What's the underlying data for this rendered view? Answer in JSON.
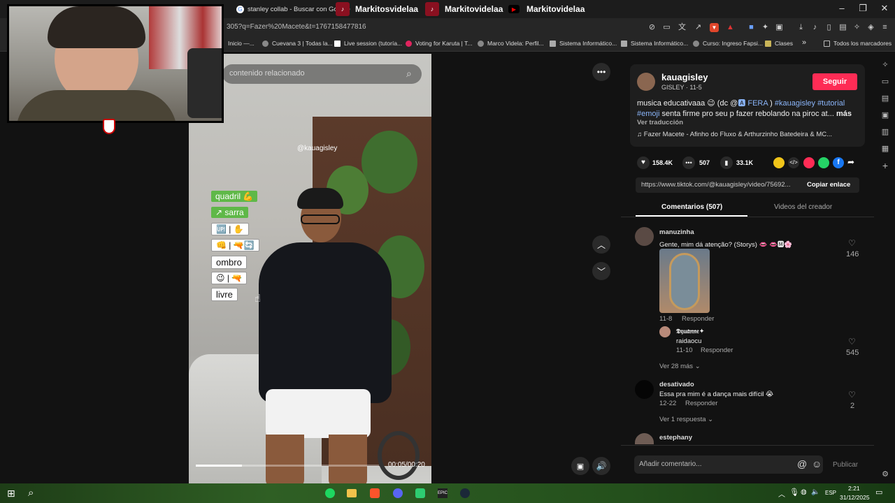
{
  "tabs": [
    {
      "label": "stanley collab - Buscar con Google"
    },
    {
      "label": "Markitosvidelaa"
    },
    {
      "label": "Markitovidelaa"
    },
    {
      "label": "Markitovidelaa"
    }
  ],
  "address_bar": {
    "url": "305?q=Fazer%20Macete&t=1767158477816"
  },
  "bookmarks": [
    {
      "label": "Inicio —..."
    },
    {
      "label": "Cuevana 3 | Todas la..."
    },
    {
      "label": "Live session (tutoría..."
    },
    {
      "label": "Voting for Karuta | T..."
    },
    {
      "label": "Marco Videla: Perfil..."
    },
    {
      "label": "Sistema Informático..."
    },
    {
      "label": "Sistema Informático..."
    },
    {
      "label": "Curso: Ingreso Fapsi..."
    },
    {
      "label": "Clases"
    },
    {
      "label": "»"
    },
    {
      "label": "Todos los marcadores"
    }
  ],
  "video": {
    "search_placeholder": "contenido relacionado",
    "watermark": "@kauagisley",
    "tags": [
      "quadril 💪",
      "↗ sarra",
      "🆙 | ✋",
      "👊 | 🔫🔄",
      "ombro",
      "😉 | 🔫",
      "livre"
    ],
    "time": "00:05/00:20",
    "progress": 0.25
  },
  "post": {
    "username": "kauagisley",
    "subtitle": "GISLEY · 11-5",
    "follow_label": "Seguir",
    "caption_prefix": "musica educativaaa 😉 (dc @",
    "caption_mention": "🅰 FERA",
    "caption_mid": ")",
    "caption_tag1": "#kauagisley",
    "caption_tag2": "#tutorial",
    "caption_tag3": "#emoji",
    "caption_rest": "senta firme pro seu p fazer rebolando na piroc at...",
    "more_label": "más",
    "translate_label": "Ver traducción",
    "music": "♫  Fazer Macete - Afinho do Fluxo & Arthurzinho Batedeira & MC...",
    "likes": "158.4K",
    "comments": "507",
    "saves": "33.1K",
    "link": "https://www.tiktok.com/@kauagisley/video/75692...",
    "copy_label": "Copiar enlace"
  },
  "panel_tabs": {
    "comments_label": "Comentarios (507)",
    "creator_label": "Videos del creador"
  },
  "comments": [
    {
      "user": "manuzinha",
      "text": "Gente, mim dá atenção? (Storys) 👄 👄🅼🌸",
      "date": "11-8",
      "reply": "Responder",
      "likes": "146"
    },
    {
      "user": "𝕯𝔶𝔲𝔞𝔫𝔫𝔢✦",
      "text": "raidaocu",
      "date": "11-10",
      "reply": "Responder",
      "likes": "545"
    },
    {
      "more": "Ver 28 más"
    },
    {
      "user": "desativado",
      "text": "Essa pra mim é a dança mais difícil 😭",
      "date": "12-22",
      "reply": "Responder",
      "likes": "2"
    },
    {
      "more": "Ver 1 respuesta"
    },
    {
      "user": "estephany"
    }
  ],
  "comment_box": {
    "placeholder": "Añadir comentario...",
    "publish": "Publicar"
  },
  "tray": {
    "lang": "ESP",
    "time": "2:21",
    "date": "31/12/2025"
  },
  "colors": {
    "accent": "#fe2c55",
    "hashtag": "#8ab4f8",
    "bg": "#121212"
  }
}
